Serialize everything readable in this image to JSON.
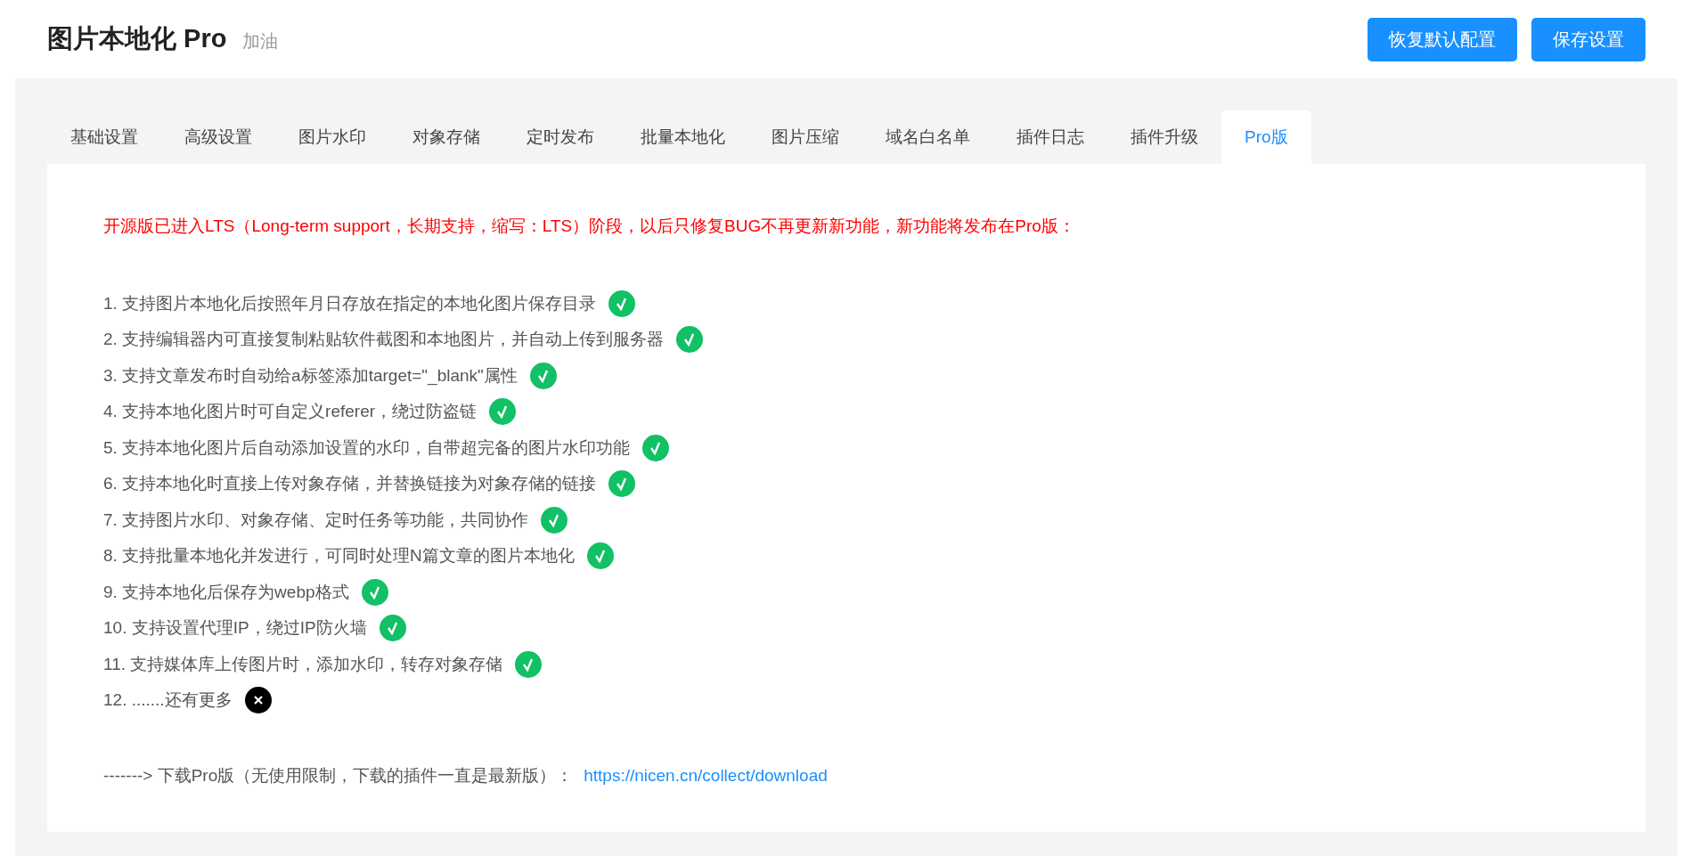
{
  "header": {
    "title": "图片本地化 Pro",
    "subtitle": "加油",
    "buttons": [
      "恢复默认配置",
      "保存设置"
    ]
  },
  "tabs": [
    {
      "label": "基础设置",
      "selected": false
    },
    {
      "label": "高级设置",
      "selected": false
    },
    {
      "label": "图片水印",
      "selected": false
    },
    {
      "label": "对象存储",
      "selected": false
    },
    {
      "label": "定时发布",
      "selected": false
    },
    {
      "label": "批量本地化",
      "selected": false
    },
    {
      "label": "图片压缩",
      "selected": false
    },
    {
      "label": "域名白名单",
      "selected": false
    },
    {
      "label": "插件日志",
      "selected": false
    },
    {
      "label": "插件升级",
      "selected": false
    },
    {
      "label": "Pro版",
      "selected": true
    }
  ],
  "notice": "开源版已进入LTS（Long-term support，长期支持，缩写：LTS）阶段，以后只修复BUG不再更新新功能，新功能将发布在Pro版：",
  "features": [
    {
      "text": "1. 支持图片本地化后按照年月日存放在指定的本地化图片保存目录",
      "kind": "check"
    },
    {
      "text": "2. 支持编辑器内可直接复制粘贴软件截图和本地图片，并自动上传到服务器",
      "kind": "check"
    },
    {
      "text": "3. 支持文章发布时自动给a标签添加target=\"_blank\"属性",
      "kind": "check"
    },
    {
      "text": "4. 支持本地化图片时可自定义referer，绕过防盗链",
      "kind": "check"
    },
    {
      "text": "5. 支持本地化图片后自动添加设置的水印，自带超完备的图片水印功能",
      "kind": "check"
    },
    {
      "text": "6. 支持本地化时直接上传对象存储，并替换链接为对象存储的链接",
      "kind": "check"
    },
    {
      "text": "7. 支持图片水印、对象存储、定时任务等功能，共同协作",
      "kind": "check"
    },
    {
      "text": "8. 支持批量本地化并发进行，可同时处理N篇文章的图片本地化",
      "kind": "check"
    },
    {
      "text": "9. 支持本地化后保存为webp格式",
      "kind": "check"
    },
    {
      "text": "10. 支持设置代理IP，绕过IP防火墙",
      "kind": "check"
    },
    {
      "text": "11. 支持媒体库上传图片时，添加水印，转存对象存储",
      "kind": "check"
    },
    {
      "text": "12. .......还有更多",
      "kind": "cross"
    }
  ],
  "download": {
    "text": "-------> 下载Pro版（无使用限制，下载的插件一直是最新版）：",
    "link": "https://nicen.cn/collect/download"
  }
}
